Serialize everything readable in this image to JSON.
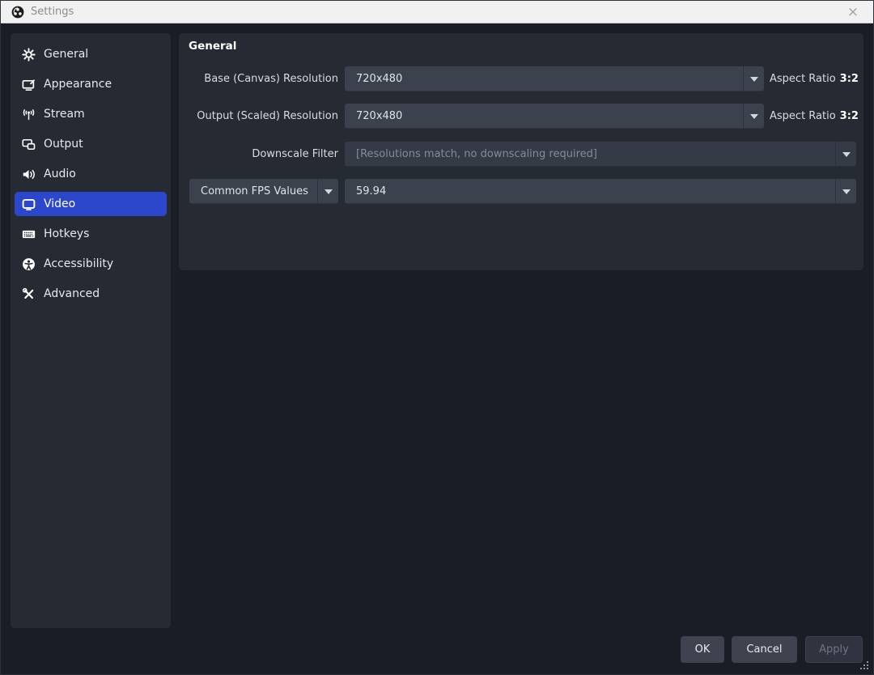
{
  "window": {
    "title": "Settings",
    "close_icon": "×"
  },
  "sidebar": {
    "items": [
      {
        "label": "General",
        "icon": "gear-icon"
      },
      {
        "label": "Appearance",
        "icon": "appearance-icon"
      },
      {
        "label": "Stream",
        "icon": "broadcast-icon"
      },
      {
        "label": "Output",
        "icon": "screens-icon"
      },
      {
        "label": "Audio",
        "icon": "speaker-icon"
      },
      {
        "label": "Video",
        "icon": "monitor-icon",
        "selected": true
      },
      {
        "label": "Hotkeys",
        "icon": "keyboard-icon"
      },
      {
        "label": "Accessibility",
        "icon": "accessibility-icon"
      },
      {
        "label": "Advanced",
        "icon": "tools-icon"
      }
    ]
  },
  "main": {
    "section_title": "General",
    "base_resolution": {
      "label": "Base (Canvas) Resolution",
      "value": "720x480",
      "aspect_label": "Aspect Ratio",
      "aspect_value": "3:2"
    },
    "output_resolution": {
      "label": "Output (Scaled) Resolution",
      "value": "720x480",
      "aspect_label": "Aspect Ratio",
      "aspect_value": "3:2"
    },
    "downscale_filter": {
      "label": "Downscale Filter",
      "value": "[Resolutions match, no downscaling required]",
      "disabled": true
    },
    "fps": {
      "selector_value": "Common FPS Values",
      "value": "59.94"
    }
  },
  "footer": {
    "ok_label": "OK",
    "cancel_label": "Cancel",
    "apply_label": "Apply"
  },
  "colors": {
    "accent": "#2c47cc",
    "panel": "#262a33",
    "window_bg": "#1a1d25",
    "combo_bg": "#3b414d",
    "titlebar_bg": "#f1f1f1"
  }
}
